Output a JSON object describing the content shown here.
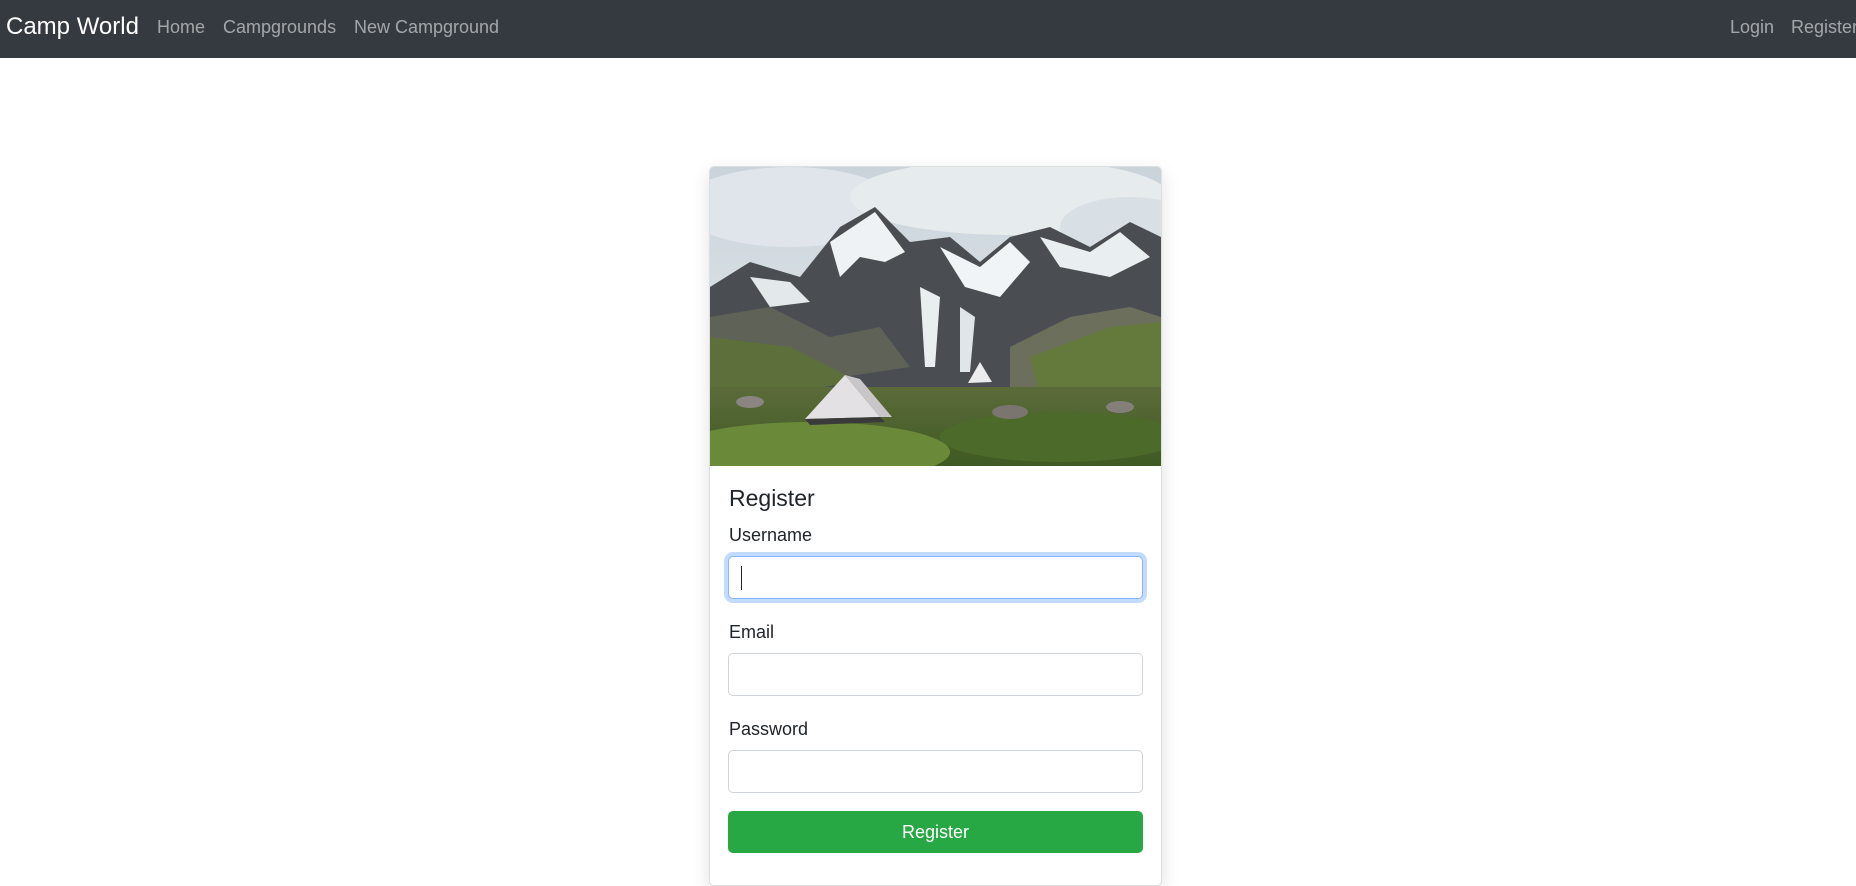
{
  "navbar": {
    "brand": "Camp World",
    "links": {
      "home": "Home",
      "campgrounds": "Campgrounds",
      "new_campground": "New Campground",
      "login": "Login",
      "register": "Register"
    },
    "background": "#343a40"
  },
  "card": {
    "image_icon": "mountain-tent-photo",
    "title": "Register",
    "fields": {
      "username": {
        "label": "Username",
        "value": ""
      },
      "email": {
        "label": "Email",
        "value": ""
      },
      "password": {
        "label": "Password",
        "value": ""
      }
    },
    "submit_label": "Register",
    "submit_color": "#28a745"
  }
}
